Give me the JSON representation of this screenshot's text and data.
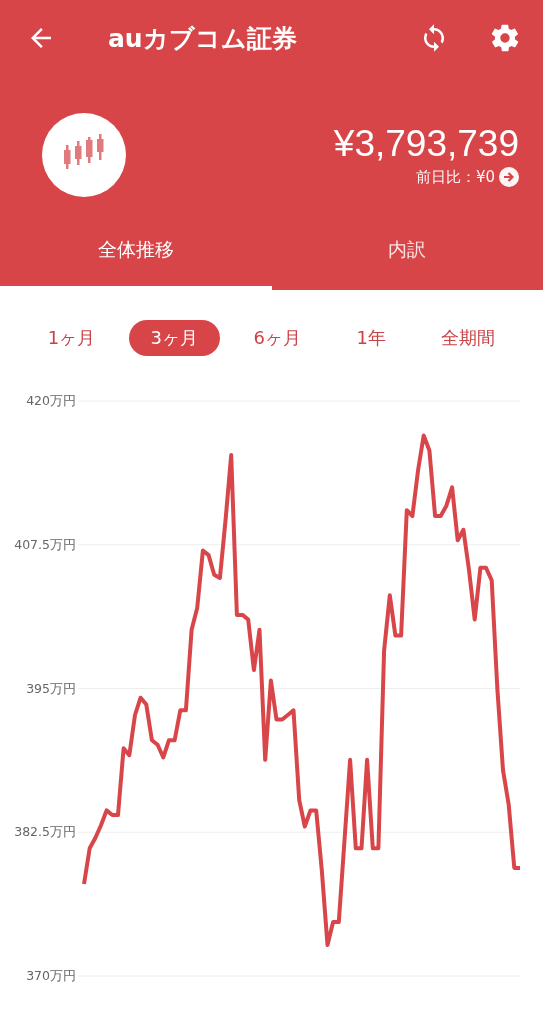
{
  "app_bar": {
    "title": "auカブコム証券"
  },
  "summary": {
    "total": "¥3,793,739",
    "change_label": "前日比：¥0"
  },
  "tabs": [
    {
      "label": "全体推移",
      "selected": true
    },
    {
      "label": "内訳",
      "selected": false
    }
  ],
  "periods": [
    {
      "label": "1ヶ月",
      "selected": false
    },
    {
      "label": "3ヶ月",
      "selected": true
    },
    {
      "label": "6ヶ月",
      "selected": false
    },
    {
      "label": "1年",
      "selected": false
    },
    {
      "label": "全期間",
      "selected": false
    }
  ],
  "chart_data": {
    "type": "line",
    "grid": true,
    "ylim": [
      370,
      420
    ],
    "yticks": [
      {
        "value": 370,
        "label": "370万円"
      },
      {
        "value": 382.5,
        "label": "382.5万円"
      },
      {
        "value": 395,
        "label": "395万円"
      },
      {
        "value": 407.5,
        "label": "407.5万円"
      },
      {
        "value": 420,
        "label": "420万円"
      }
    ],
    "categories": [
      null,
      null,
      null,
      null,
      null,
      null,
      null,
      null,
      null,
      null,
      null,
      null,
      null,
      null,
      null,
      null,
      null,
      null,
      null,
      null,
      null,
      null,
      null,
      null,
      null,
      null,
      null,
      null,
      null,
      null,
      null,
      null,
      null,
      null,
      null,
      null,
      null,
      null,
      null,
      null,
      null,
      null,
      null,
      null,
      null,
      null,
      null,
      null,
      null,
      null,
      null,
      null,
      null,
      null,
      null,
      null,
      null,
      null,
      null,
      null,
      null,
      null,
      null,
      null,
      null,
      null,
      null,
      null,
      null,
      null,
      null,
      null,
      null,
      null,
      null,
      null,
      null,
      null
    ],
    "series": [
      {
        "color": "#d9464a",
        "values": [
          378.0,
          381.1,
          382.0,
          383.1,
          384.4,
          384.0,
          384.0,
          389.8,
          389.2,
          392.7,
          394.2,
          393.6,
          390.5,
          390.1,
          389.0,
          390.5,
          390.5,
          393.1,
          393.1,
          400.1,
          402.0,
          407.0,
          406.6,
          404.9,
          404.6,
          409.7,
          415.3,
          401.4,
          401.4,
          401.0,
          396.6,
          400.1,
          388.8,
          395.7,
          392.3,
          392.3,
          392.7,
          393.1,
          385.3,
          383.0,
          384.4,
          384.4,
          379.2,
          372.7,
          374.7,
          374.7,
          381.8,
          388.8,
          381.1,
          381.1,
          388.8,
          381.1,
          381.1,
          398.3,
          403.1,
          399.6,
          399.6,
          410.5,
          410.0,
          414.0,
          417.0,
          415.7,
          410.0,
          410.0,
          410.9,
          412.5,
          407.9,
          408.8,
          405.3,
          401.0,
          405.5,
          405.5,
          404.4,
          394.9,
          387.9,
          384.9,
          379.4,
          379.4
        ]
      }
    ]
  }
}
